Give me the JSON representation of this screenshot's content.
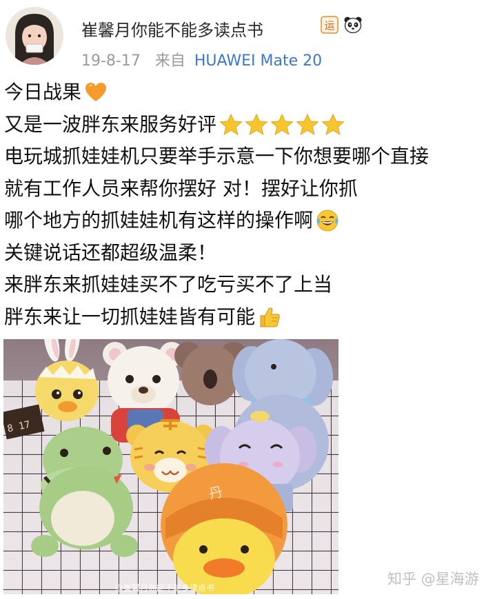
{
  "user": {
    "name": "崔馨月你能不能多读点书",
    "timestamp": "19-8-17",
    "source_prefix": "来自",
    "device": "HUAWEI Mate 20",
    "badges": [
      "运",
      "panda-icon"
    ]
  },
  "post": {
    "lines": [
      "今日战果",
      "又是一波胖东来服务好评",
      "电玩城抓娃娃机只要举手示意一下你想要哪个直接",
      "就有工作人员来帮你摆好 对！摆好让你抓",
      "哪个地方的抓娃娃机有这样的操作啊",
      "关键说话还都超级温柔！",
      "来胖东来抓娃娃买不了吃亏买不了上当",
      "胖东来让一切抓娃娃皆有可能"
    ],
    "emojis": {
      "line1": "orange-heart-icon",
      "line2": "star-icon",
      "line5": "tears-of-joy-icon",
      "line8": "thumbs-up-icon"
    },
    "star_count": 5
  },
  "photo": {
    "watermark": "@崔馨月你能不能多读点书",
    "date_sign": "8 17"
  },
  "site_watermark": "知乎 @星海游",
  "colors": {
    "device_link": "#3a79c9",
    "meta_gray": "#9a9a9a",
    "star": "#f7c52d",
    "heart": "#f59a2c"
  }
}
